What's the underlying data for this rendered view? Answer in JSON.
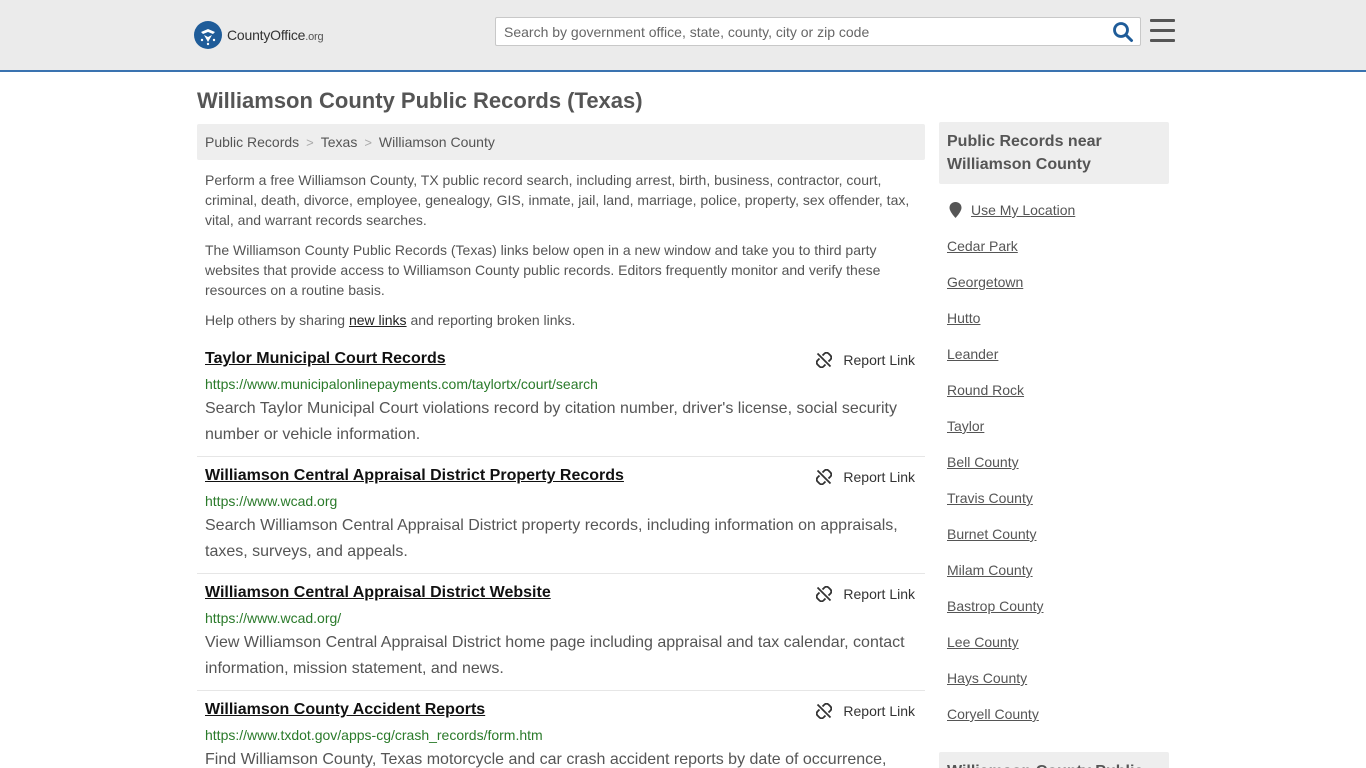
{
  "header": {
    "logo_main": "CountyOffice",
    "logo_suffix": ".org",
    "search_placeholder": "Search by government office, state, county, city or zip code"
  },
  "page_title": "Williamson County Public Records (Texas)",
  "breadcrumb": [
    "Public Records",
    "Texas",
    "Williamson County"
  ],
  "intro": {
    "p1": "Perform a free Williamson County, TX public record search, including arrest, birth, business, contractor, court, criminal, death, divorce, employee, genealogy, GIS, inmate, jail, land, marriage, police, property, sex offender, tax, vital, and warrant records searches.",
    "p2": "The Williamson County Public Records (Texas) links below open in a new window and take you to third party websites that provide access to Williamson County public records. Editors frequently monitor and verify these resources on a routine basis.",
    "p3_before": "Help others by sharing ",
    "p3_link": "new links",
    "p3_after": " and reporting broken links."
  },
  "report_label": "Report Link",
  "records": [
    {
      "title": "Taylor Municipal Court Records",
      "url": "https://www.municipalonlinepayments.com/taylortx/court/search",
      "description": "Search Taylor Municipal Court violations record by citation number, driver's license, social security number or vehicle information."
    },
    {
      "title": "Williamson Central Appraisal District Property Records",
      "url": "https://www.wcad.org",
      "description": "Search Williamson Central Appraisal District property records, including information on appraisals, taxes, surveys, and appeals."
    },
    {
      "title": "Williamson Central Appraisal District Website",
      "url": "https://www.wcad.org/",
      "description": "View Williamson Central Appraisal District home page including appraisal and tax calendar, contact information, mission statement, and news."
    },
    {
      "title": "Williamson County Accident Reports",
      "url": "https://www.txdot.gov/apps-cg/crash_records/form.htm",
      "description": "Find Williamson County, Texas motorcycle and car crash accident reports by date of occurrence,"
    }
  ],
  "sidebar": {
    "heading": "Public Records near Williamson County",
    "use_location": "Use My Location",
    "links": [
      "Cedar Park",
      "Georgetown",
      "Hutto",
      "Leander",
      "Round Rock",
      "Taylor",
      "Bell County",
      "Travis County",
      "Burnet County",
      "Milam County",
      "Bastrop County",
      "Lee County",
      "Hays County",
      "Coryell County"
    ],
    "heading2": "Williamson County Public"
  }
}
